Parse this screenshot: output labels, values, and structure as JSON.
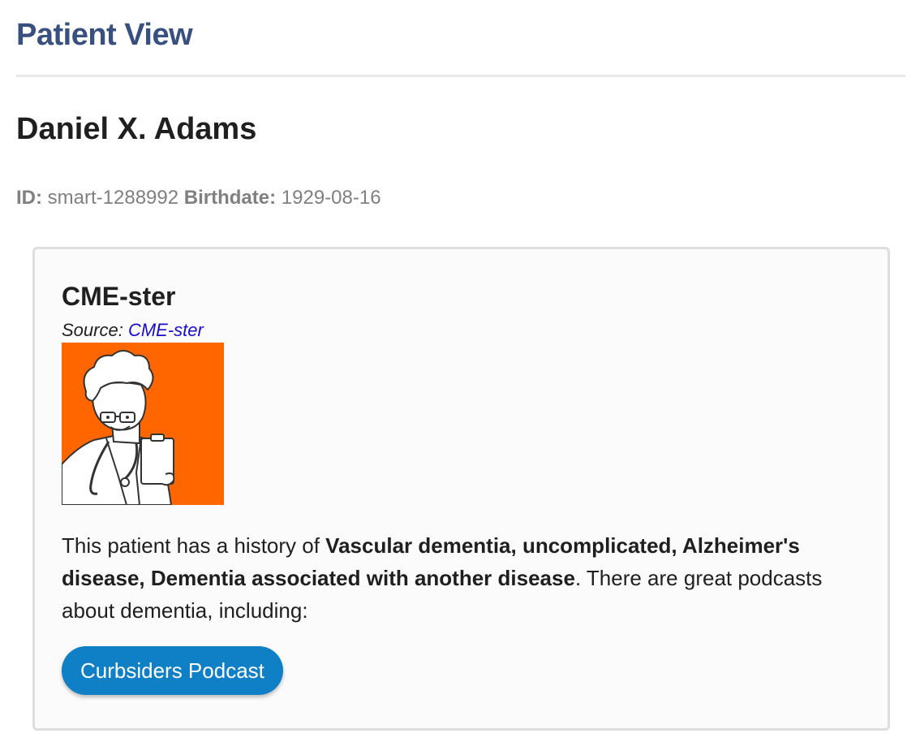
{
  "header": {
    "title": "Patient View"
  },
  "patient": {
    "name": "Daniel X. Adams",
    "id_label": "ID:",
    "id_value": "smart-1288992",
    "birthdate_label": "Birthdate:",
    "birthdate_value": "1929-08-16"
  },
  "card": {
    "title": "CME-ster",
    "source_label": "Source:",
    "source_link": "CME-ster",
    "logo_icon": "doctor-cartoon-logo",
    "logo_bg_color": "#ff6600",
    "summary_prefix": "This patient has a history of ",
    "summary_conditions": "Vascular dementia, uncomplicated, Alzheimer's disease, Dementia associated with another disease",
    "summary_suffix": ". There are great podcasts about dementia, including:",
    "button_label": "Curbsiders Podcast",
    "button_color": "#0f7fc6"
  },
  "colors": {
    "title": "#37507f",
    "link": "#1a0dcc"
  }
}
